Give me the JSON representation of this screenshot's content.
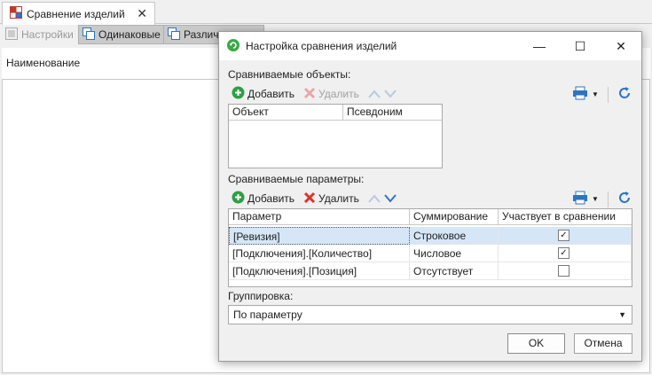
{
  "doc_tab": {
    "title": "Сравнение изделий"
  },
  "toolbar": {
    "settings": "Настройки",
    "identical": "Одинаковые",
    "different": "Различ"
  },
  "bg": {
    "column_name": "Наименование"
  },
  "dialog": {
    "title": "Настройка сравнения изделий",
    "objects_label": "Сравниваемые объекты:",
    "params_label": "Сравниваемые параметры:",
    "add": "Добавить",
    "remove": "Удалить",
    "objects_columns": [
      "Объект",
      "Псевдоним"
    ],
    "params_columns": [
      "Параметр",
      "Суммирование",
      "Участвует в сравнении"
    ],
    "params_rows": [
      {
        "param": "[Ревизия]",
        "sum": "Строковое",
        "included": true
      },
      {
        "param": "[Подключения].[Количество]",
        "sum": "Числовое",
        "included": true
      },
      {
        "param": "[Подключения].[Позиция]",
        "sum": "Отсутствует",
        "included": false
      }
    ],
    "grouping_label": "Группировка:",
    "grouping_value": "По параметру",
    "ok": "OK",
    "cancel": "Отмена"
  },
  "colors": {
    "add_green": "#2f9e44",
    "remove_red": "#d9342b",
    "accent_blue": "#2d74c4",
    "selection": "#d5e6f7"
  }
}
